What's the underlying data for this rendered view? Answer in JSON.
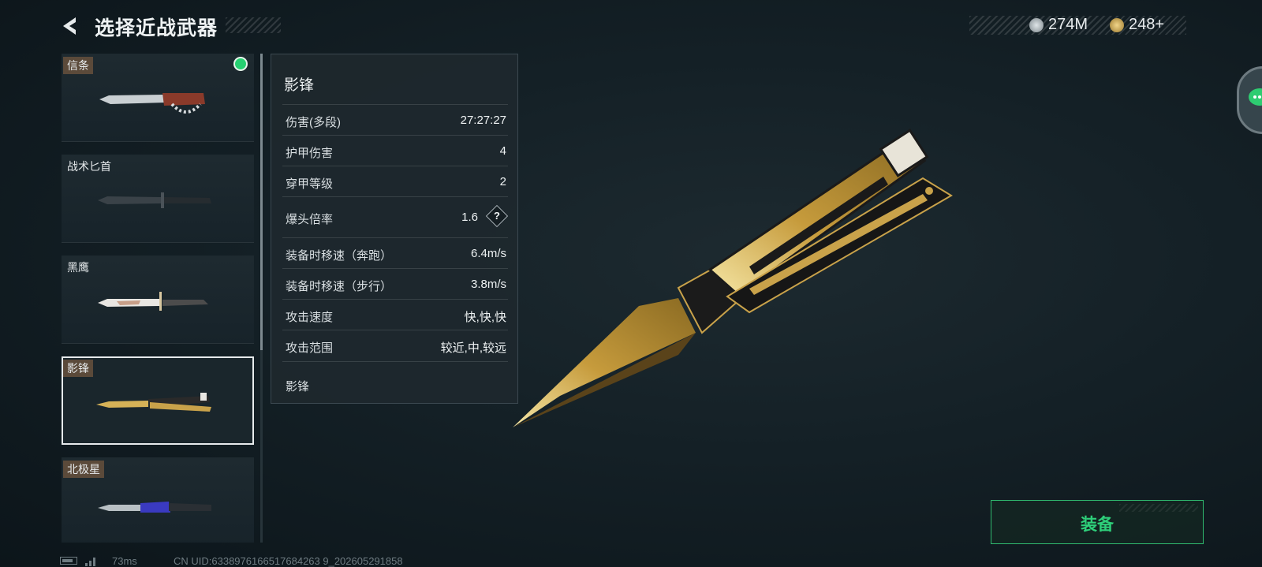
{
  "header": {
    "title": "选择近战武器",
    "currency": [
      {
        "icon": "coin-icon",
        "value": "274M",
        "color": "#b8c0c4"
      },
      {
        "icon": "gold-coin-icon",
        "value": "248+",
        "color": "#c9a24a"
      }
    ]
  },
  "weapons": [
    {
      "name": "信条",
      "tagged": true,
      "equipped": true,
      "selected": false
    },
    {
      "name": "战术匕首",
      "tagged": false,
      "equipped": false,
      "selected": false
    },
    {
      "name": "黑鹰",
      "tagged": false,
      "equipped": false,
      "selected": false
    },
    {
      "name": "影锋",
      "tagged": true,
      "equipped": false,
      "selected": true
    },
    {
      "name": "北极星",
      "tagged": true,
      "equipped": false,
      "selected": false
    }
  ],
  "stats": {
    "name": "影锋",
    "rows": [
      {
        "label": "伤害(多段)",
        "value": "27:27:27"
      },
      {
        "label": "护甲伤害",
        "value": "4"
      },
      {
        "label": "穿甲等级",
        "value": "2"
      },
      {
        "label": "爆头倍率",
        "value": "1.6",
        "help": "?"
      },
      {
        "label": "装备时移速（奔跑）",
        "value": "6.4m/s"
      },
      {
        "label": "装备时移速（步行）",
        "value": "3.8m/s"
      },
      {
        "label": "攻击速度",
        "value": "快,快,快"
      },
      {
        "label": "攻击范围",
        "value": "较近,中,较远"
      }
    ],
    "description": "影锋"
  },
  "equip_button": {
    "label": "装备",
    "color": "#2ed07a"
  },
  "footer": {
    "ping": "73ms",
    "uid": "CN UID:6338976166517684263 9_202605291858"
  }
}
